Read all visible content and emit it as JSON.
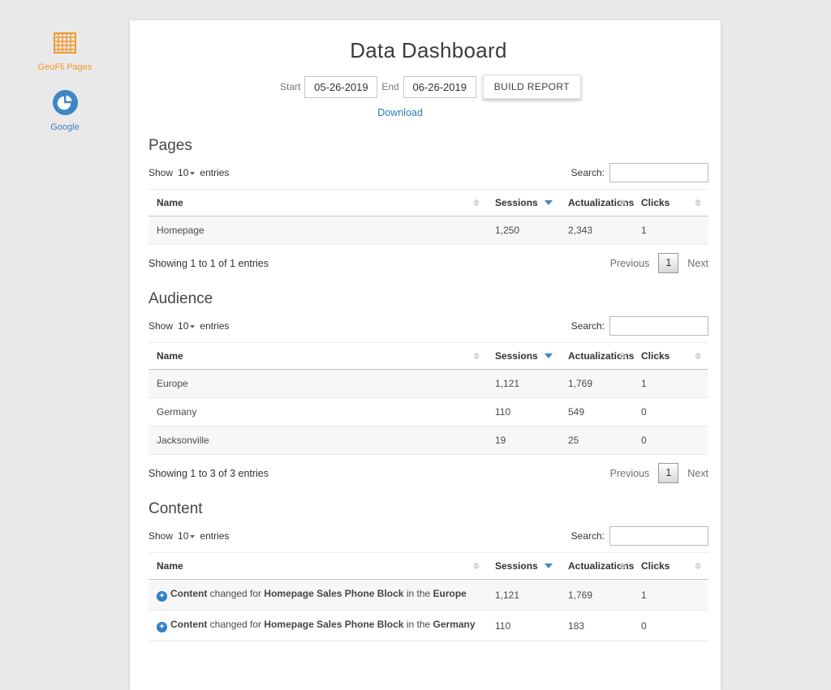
{
  "title": "Data Dashboard",
  "sidebar": {
    "geofli_label": "GeoFli Pages",
    "google_label": "Google"
  },
  "report_bar": {
    "start_label": "Start",
    "start_value": "05-26-2019",
    "end_label": "End",
    "end_value": "06-26-2019",
    "build_button": "BUILD REPORT",
    "download_link": "Download"
  },
  "table_controls": {
    "show_prefix": "Show",
    "show_value": "10",
    "show_suffix": "entries",
    "search_label": "Search:"
  },
  "columns": {
    "name": "Name",
    "sessions": "Sessions",
    "actualizations": "Actualizations",
    "clicks": "Clicks"
  },
  "pagination": {
    "previous": "Previous",
    "page": "1",
    "next": "Next"
  },
  "icons": {
    "plus": "+"
  },
  "colors": {
    "accent_orange": "#f0982f",
    "accent_blue": "#3e86c6",
    "link_blue": "#337ab7",
    "sort_active": "#3a87c8"
  },
  "sections": {
    "pages": {
      "title": "Pages",
      "rows": [
        {
          "name": "Homepage",
          "sessions": "1,250",
          "actualizations": "2,343",
          "clicks": "1"
        }
      ],
      "info": "Showing 1 to 1 of 1 entries"
    },
    "audience": {
      "title": "Audience",
      "rows": [
        {
          "name": "Europe",
          "sessions": "1,121",
          "actualizations": "1,769",
          "clicks": "1"
        },
        {
          "name": "Germany",
          "sessions": "110",
          "actualizations": "549",
          "clicks": "0"
        },
        {
          "name": "Jacksonville",
          "sessions": "19",
          "actualizations": "25",
          "clicks": "0"
        }
      ],
      "info": "Showing 1 to 3 of 3 entries"
    },
    "content": {
      "title": "Content",
      "rows": [
        {
          "bold1": "Content",
          "text1": "changed for",
          "bold2": "Homepage Sales Phone Block",
          "text2": "in the",
          "bold3": "Europe",
          "sessions": "1,121",
          "actualizations": "1,769",
          "clicks": "1"
        },
        {
          "bold1": "Content",
          "text1": "changed for",
          "bold2": "Homepage Sales Phone Block",
          "text2": "in the",
          "bold3": "Germany",
          "sessions": "110",
          "actualizations": "183",
          "clicks": "0"
        }
      ]
    }
  }
}
